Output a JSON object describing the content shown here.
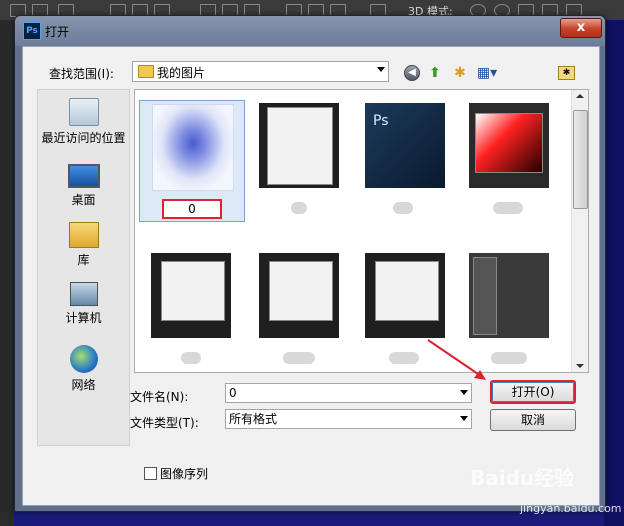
{
  "photoshop": {
    "mode_label": "3D 模式:"
  },
  "dialog": {
    "title": "打开",
    "close_label": "x",
    "lookin_label": "查找范围(I):",
    "lookin_value": "我的图片",
    "places": [
      {
        "label": "最近访问的位置",
        "icon": "recent-places-icon"
      },
      {
        "label": "桌面",
        "icon": "desktop-icon"
      },
      {
        "label": "库",
        "icon": "library-icon"
      },
      {
        "label": "计算机",
        "icon": "computer-icon"
      },
      {
        "label": "网络",
        "icon": "network-icon"
      }
    ],
    "files": [
      {
        "name": "0",
        "thumbnail": "blue-flower-image",
        "selected": true
      },
      {
        "name": "",
        "thumbnail": "settings-window-screenshot"
      },
      {
        "name": "",
        "thumbnail": "photoshop-splash-screen",
        "ps_text": "Ps"
      },
      {
        "name": "",
        "thumbnail": "color-picker-screenshot"
      },
      {
        "name": "",
        "thumbnail": "dialog-screenshot"
      },
      {
        "name": "",
        "thumbnail": "dialog-screenshot"
      },
      {
        "name": "",
        "thumbnail": "dialog-screenshot"
      },
      {
        "name": "",
        "thumbnail": "photoshop-workspace-screenshot"
      }
    ],
    "filename_label": "文件名(N):",
    "filename_value": "0",
    "filetype_label": "文件类型(T):",
    "filetype_value": "所有格式",
    "open_label": "打开(O)",
    "cancel_label": "取消",
    "image_sequence_label": "图像序列",
    "image_sequence_checked": false
  },
  "watermark": {
    "text": "Baidu经验",
    "url": "jingyan.baidu.com"
  },
  "colors": {
    "highlight_red": "#e02030",
    "selection_blue": "#dde9f7"
  }
}
